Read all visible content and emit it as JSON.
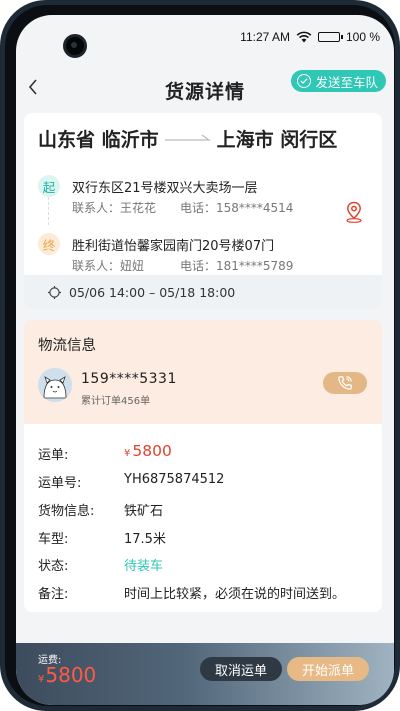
{
  "status_bar": {
    "time": "11:27 AM",
    "battery": "100 %"
  },
  "header": {
    "title": "货源详情",
    "send_fleet_label": "发送至车队"
  },
  "route": {
    "origin": "山东省 临沂市",
    "destination": "上海市 闵行区",
    "pickup": {
      "badge": "起",
      "address": "双行东区21号楼双兴大卖场一层",
      "contact": "联系人：王花花",
      "phone": "电话：158****4514"
    },
    "dropoff": {
      "badge": "终",
      "address": "胜利街道怡馨家园南门20号楼07门",
      "contact": "联系人：妞妞",
      "phone": "电话：181****5789"
    },
    "time_range": "05/06 14:00 – 05/18 18:00"
  },
  "logistics": {
    "title": "物流信息",
    "shipper_phone": "159****5331",
    "order_count": "累计订单456单"
  },
  "details": {
    "freight_label": "运单:",
    "currency": "¥",
    "freight_value": "5800",
    "waybill_label": "运单号:",
    "waybill_value": "YH6875874512",
    "cargo_label": "货物信息:",
    "cargo_value": "铁矿石",
    "vehicle_label": "车型:",
    "vehicle_value": "17.5米",
    "status_label": "状态:",
    "status_value": "待装车",
    "note_label": "备注:",
    "note_value": "时间上比较紧，必须在说的时间送到。"
  },
  "footer": {
    "fee_label": "运费:",
    "currency": "¥",
    "fee_value": "5800",
    "cancel_label": "取消运单",
    "dispatch_label": "开始派单"
  },
  "colors": {
    "accent_teal": "#2fc7b6",
    "price_red": "#e2432c",
    "gold": "#e6b985",
    "logistics_bg": "#fdece1"
  }
}
